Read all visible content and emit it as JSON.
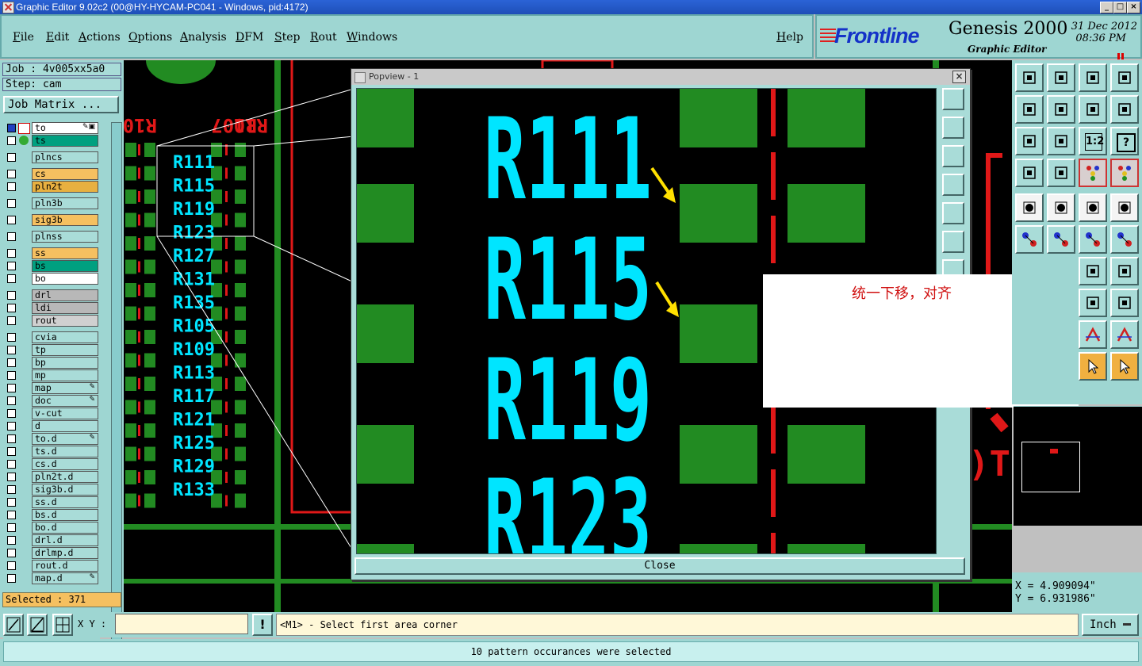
{
  "window": {
    "title": "Graphic Editor 9.02c2 (00@HY-HYCAM-PC041 - Windows, pid:4172)",
    "btn_min": "_",
    "btn_max": "□",
    "btn_close": "×"
  },
  "menu": {
    "items": [
      "File",
      "Edit",
      "Actions",
      "Options",
      "Analysis",
      "DFM",
      "Step",
      "Rout",
      "Windows"
    ],
    "help": "Help"
  },
  "brand": {
    "logo": "Frontline",
    "product": "Genesis 2000",
    "subtitle": "Graphic Editor",
    "date": "31 Dec 2012",
    "time": "08:36 PM"
  },
  "job": {
    "job_label": "Job : 4v005xx5a0",
    "step_label": "Step: cam",
    "matrix_button": "Job Matrix ..."
  },
  "layers": [
    {
      "name": "to",
      "color": "#ffffff",
      "aff": "✎▣"
    },
    {
      "name": "ts",
      "color": "#00a080",
      "aff": ""
    },
    {
      "name": "plncs",
      "color": "#a9dcd8",
      "aff": ""
    },
    {
      "name": "cs",
      "color": "#f5c060",
      "aff": ""
    },
    {
      "name": "pln2t",
      "color": "#e8b040",
      "aff": ""
    },
    {
      "name": "pln3b",
      "color": "#a9dcd8",
      "aff": ""
    },
    {
      "name": "sig3b",
      "color": "#f5c060",
      "aff": ""
    },
    {
      "name": "plnss",
      "color": "#a9dcd8",
      "aff": ""
    },
    {
      "name": "ss",
      "color": "#f5c060",
      "aff": ""
    },
    {
      "name": "bs",
      "color": "#00a080",
      "aff": ""
    },
    {
      "name": "bo",
      "color": "#ffffff",
      "aff": ""
    },
    {
      "name": "drl",
      "color": "#b8b8b8",
      "aff": ""
    },
    {
      "name": "ldi",
      "color": "#b8b8b8",
      "aff": ""
    },
    {
      "name": "rout",
      "color": "#d0d0d0",
      "aff": ""
    },
    {
      "name": "cvia",
      "color": "#a9dcd8",
      "aff": ""
    },
    {
      "name": "tp",
      "color": "#a9dcd8",
      "aff": ""
    },
    {
      "name": "bp",
      "color": "#a9dcd8",
      "aff": ""
    },
    {
      "name": "mp",
      "color": "#a9dcd8",
      "aff": ""
    },
    {
      "name": "map",
      "color": "#a9dcd8",
      "aff": "✎"
    },
    {
      "name": "doc",
      "color": "#a9dcd8",
      "aff": "✎"
    },
    {
      "name": "v-cut",
      "color": "#a9dcd8",
      "aff": ""
    },
    {
      "name": "d",
      "color": "#a9dcd8",
      "aff": ""
    },
    {
      "name": "to.d",
      "color": "#a9dcd8",
      "aff": "✎"
    },
    {
      "name": "ts.d",
      "color": "#a9dcd8",
      "aff": ""
    },
    {
      "name": "cs.d",
      "color": "#a9dcd8",
      "aff": ""
    },
    {
      "name": "pln2t.d",
      "color": "#a9dcd8",
      "aff": ""
    },
    {
      "name": "sig3b.d",
      "color": "#a9dcd8",
      "aff": ""
    },
    {
      "name": "ss.d",
      "color": "#a9dcd8",
      "aff": ""
    },
    {
      "name": "bs.d",
      "color": "#a9dcd8",
      "aff": ""
    },
    {
      "name": "bo.d",
      "color": "#a9dcd8",
      "aff": ""
    },
    {
      "name": "drl.d",
      "color": "#a9dcd8",
      "aff": ""
    },
    {
      "name": "drlmp.d",
      "color": "#a9dcd8",
      "aff": ""
    },
    {
      "name": "rout.d",
      "color": "#a9dcd8",
      "aff": ""
    },
    {
      "name": "map.d",
      "color": "#a9dcd8",
      "aff": "✎"
    }
  ],
  "selected_label": "Selected : 371",
  "canvas": {
    "silk_labels": [
      "R111",
      "R115",
      "R119",
      "R123",
      "R127",
      "R131",
      "R135",
      "R105",
      "R109",
      "R113",
      "R117",
      "R121",
      "R125",
      "R129",
      "R133"
    ],
    "mirror_labels": [
      "R10",
      "R107",
      "R10"
    ],
    "right_mirror": "T("
  },
  "popview": {
    "title": "Popview - 1",
    "labels": [
      "R111",
      "R115",
      "R119",
      "R123"
    ],
    "close_label": "Close"
  },
  "note": {
    "text": "统一下移，对齐"
  },
  "toolbox": {
    "scale_label": "1:2",
    "help_label": "?"
  },
  "coords": {
    "x": "X = 4.909094\"",
    "y": "Y = 6.931986\""
  },
  "status": {
    "xy_label": "X Y :",
    "xy_value": "",
    "prompt": "<M1> - Select first area corner",
    "alert": "!",
    "units": "Inch",
    "message": "10 pattern occurances were selected"
  },
  "colors": {
    "pad_green": "#228b22",
    "silk_cyan": "#00e5ff",
    "rout_red": "#e01818",
    "panel": "#9ed6d2",
    "arrow_yellow": "#ffe000"
  }
}
